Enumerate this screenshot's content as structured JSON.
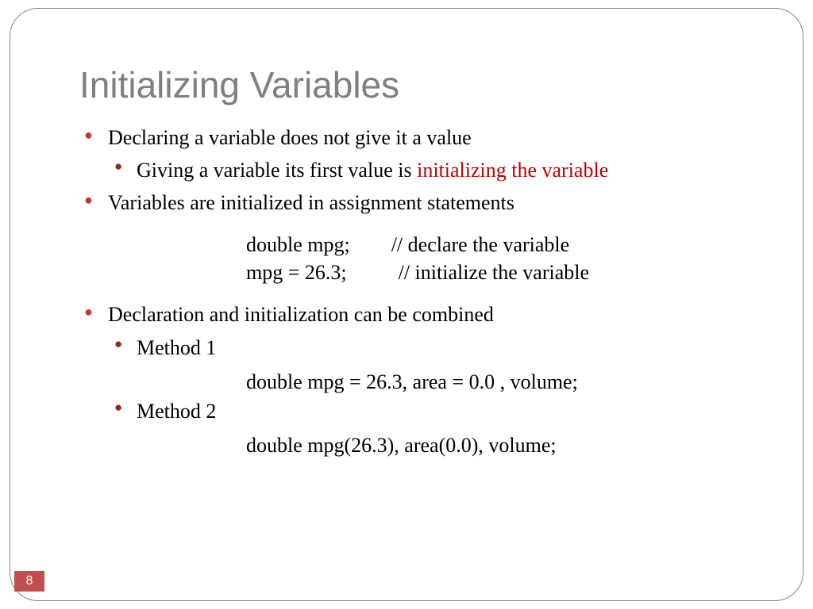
{
  "title": "Initializing Variables",
  "bullets": {
    "b1": "Declaring a variable does not give it a value",
    "b1a_pre": "Giving a variable its first value is ",
    "b1a_hl": "initializing the variable",
    "b2": "Variables are initialized  in assignment statements",
    "code1_l1": "double mpg;        // declare the variable",
    "code1_l2": "mpg = 26.3;          // initialize the variable",
    "b3": "Declaration and initialization can be combined",
    "b3a": "Method 1",
    "code2": "double mpg = 26.3, area = 0.0 ,  volume;",
    "b3b": "Method 2",
    "code3": "double mpg(26.3),  area(0.0), volume;"
  },
  "page": "8"
}
